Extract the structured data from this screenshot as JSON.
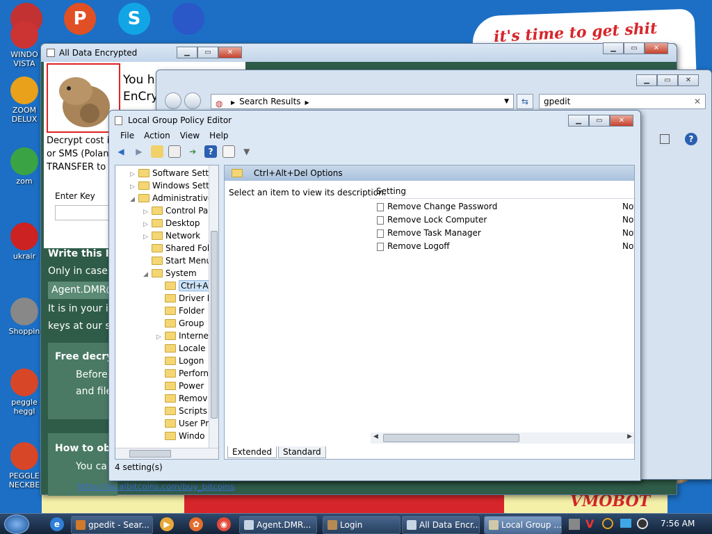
{
  "desktop_icons": [
    {
      "label": "WINDO\nVISTA",
      "icon": "vista-icon",
      "color": "#cc3333"
    },
    {
      "label": "ZOOM\nDELUX",
      "icon": "zoom-icon",
      "color": "#e9a11b"
    },
    {
      "label": "zom",
      "icon": "flower-icon",
      "color": "#3aa444"
    },
    {
      "label": "ukrair",
      "icon": "radiation-icon",
      "color": "#cc2222"
    },
    {
      "label": "Shoppin",
      "icon": "flash-icon",
      "color": "#888888"
    },
    {
      "label": "peggle\nheggl",
      "icon": "peggle-icon",
      "color": "#d84628"
    },
    {
      "label": "PEGGLE\nNECKBE",
      "icon": "peggle-icon",
      "color": "#d84628"
    }
  ],
  "top_icons": [
    {
      "icon": "vista-ball-icon",
      "color": "#c23232"
    },
    {
      "icon": "peggle-p-icon",
      "color": "#e05024",
      "text": "P"
    },
    {
      "icon": "skype-icon",
      "color": "#12a5e6",
      "text": "S"
    },
    {
      "icon": "globe-icon",
      "color": "#2a58c8"
    }
  ],
  "wallpaper": {
    "top_text": "it's time to get shit",
    "bottom_text": "VMOBOT"
  },
  "ransom_window": {
    "title": "All Data Encrypted",
    "heading_partial": "You h\nEnCry",
    "body_partial": "Decrypt cost is\nor SMS (Polan\nTRANSFER to",
    "key_label": "Enter Key",
    "section_write": "Write this I",
    "only_in_case": "Only in case",
    "agent_field": "Agent.DMR@",
    "in_your": "It is in your in",
    "keys_at": "keys at our s",
    "free_decrypt": "Free decry",
    "before": "Before",
    "and_file": "and file",
    "how_to": "How to ob",
    "you_can": "You ca",
    "link": "https://localbitcoins.com/buy_bitcoins"
  },
  "explorer_window": {
    "address": "Search Results",
    "search_value": "gpedit"
  },
  "gpe": {
    "title": "Local Group Policy Editor",
    "menu": [
      "File",
      "Action",
      "View",
      "Help"
    ],
    "tree": [
      {
        "label": "Software Setti",
        "indent": 1,
        "arrow": "▷"
      },
      {
        "label": "Windows Sett",
        "indent": 1,
        "arrow": "▷"
      },
      {
        "label": "Administrative",
        "indent": 1,
        "arrow": "◢"
      },
      {
        "label": "Control Pa",
        "indent": 2,
        "arrow": "▷"
      },
      {
        "label": "Desktop",
        "indent": 2,
        "arrow": "▷"
      },
      {
        "label": "Network",
        "indent": 2,
        "arrow": "▷"
      },
      {
        "label": "Shared Fol",
        "indent": 2,
        "arrow": ""
      },
      {
        "label": "Start Menu",
        "indent": 2,
        "arrow": ""
      },
      {
        "label": "System",
        "indent": 2,
        "arrow": "◢"
      },
      {
        "label": "Ctrl+A",
        "indent": 3,
        "arrow": "",
        "selected": true
      },
      {
        "label": "Driver I",
        "indent": 3,
        "arrow": ""
      },
      {
        "label": "Folder",
        "indent": 3,
        "arrow": ""
      },
      {
        "label": "Group",
        "indent": 3,
        "arrow": ""
      },
      {
        "label": "Interne",
        "indent": 3,
        "arrow": "▷"
      },
      {
        "label": "Locale",
        "indent": 3,
        "arrow": ""
      },
      {
        "label": "Logon",
        "indent": 3,
        "arrow": ""
      },
      {
        "label": "Perforn",
        "indent": 3,
        "arrow": ""
      },
      {
        "label": "Power",
        "indent": 3,
        "arrow": ""
      },
      {
        "label": "Remov",
        "indent": 3,
        "arrow": ""
      },
      {
        "label": "Scripts",
        "indent": 3,
        "arrow": ""
      },
      {
        "label": "User Pr",
        "indent": 3,
        "arrow": ""
      },
      {
        "label": "Windo",
        "indent": 3,
        "arrow": ""
      }
    ],
    "folder_header": "Ctrl+Alt+Del Options",
    "description": "Select an item to view its description.",
    "column_setting": "Setting",
    "settings": [
      {
        "name": "Remove Change Password",
        "state": "Not"
      },
      {
        "name": "Remove Lock Computer",
        "state": "Not"
      },
      {
        "name": "Remove Task Manager",
        "state": "Not"
      },
      {
        "name": "Remove Logoff",
        "state": "Not"
      }
    ],
    "tabs": [
      "Extended",
      "Standard"
    ],
    "status": "4 setting(s)"
  },
  "taskbar": {
    "buttons": [
      {
        "label": "gpedit - Sear...",
        "icon": "search-icon",
        "color": "#d07a2a"
      },
      {
        "label": "Agent.DMR...",
        "icon": "window-icon",
        "color": "#c7d4e4"
      },
      {
        "label": "Login",
        "icon": "hamster-icon",
        "color": "#b78a53"
      },
      {
        "label": "All Data Encr...",
        "icon": "window-icon",
        "color": "#c7d4e4"
      },
      {
        "label": "Local Group ...",
        "icon": "policy-icon",
        "color": "#d0c9a8"
      }
    ],
    "quick": [
      {
        "icon": "ie-icon",
        "color": "#2f7fd8",
        "text": "e"
      },
      {
        "icon": "media-player-icon",
        "color": "#e8a838",
        "text": "▶"
      },
      {
        "icon": "paint-icon",
        "color": "#e36c2c",
        "text": "✿"
      },
      {
        "icon": "chrome-icon",
        "color": "#e34a3a",
        "text": "◉"
      }
    ],
    "time": "7:56 AM"
  }
}
